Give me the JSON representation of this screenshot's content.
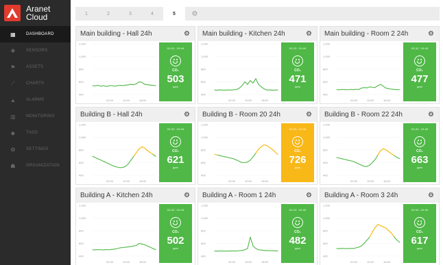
{
  "brand": {
    "line1": "Aranet",
    "line2": "Cloud"
  },
  "sidebar": {
    "items": [
      {
        "label": "DASHBOARD",
        "icon": "dashboard-icon",
        "glyph": "▦"
      },
      {
        "label": "SENSORS",
        "icon": "sensor-icon",
        "glyph": "✺"
      },
      {
        "label": "ASSETS",
        "icon": "asset-icon",
        "glyph": "⚑"
      },
      {
        "label": "CHARTS",
        "icon": "chart-icon",
        "glyph": "⟋"
      },
      {
        "label": "ALARMS",
        "icon": "alarm-icon",
        "glyph": "▲"
      },
      {
        "label": "MONITORING",
        "icon": "monitoring-icon",
        "glyph": "▥"
      },
      {
        "label": "TAGS",
        "icon": "tag-icon",
        "glyph": "◆"
      },
      {
        "label": "SETTINGS",
        "icon": "settings-icon",
        "glyph": "✿"
      },
      {
        "label": "ORGANIZATION",
        "icon": "organization-icon",
        "glyph": "☗"
      }
    ]
  },
  "tabs": [
    "1",
    "2",
    "3",
    "4",
    "5"
  ],
  "active_tab": "5",
  "axis_labels": [
    "1,200",
    "1,000",
    "800",
    "600",
    "400"
  ],
  "x_labels": [
    "02:00",
    "10:00",
    "18:00"
  ],
  "colors": {
    "green": "#4fb846",
    "yellow": "#f8b818",
    "line_green": "#4fb846",
    "line_yellow": "#f5b400"
  },
  "cards": [
    {
      "title": "Main building - Hall 24h",
      "time": "03.02. 19:49",
      "co2": "CO₂",
      "value": "503",
      "unit": "ppm",
      "status": "green",
      "series": [
        540,
        535,
        545,
        530,
        538,
        528,
        536,
        542,
        530,
        538,
        545,
        540,
        548,
        552,
        560,
        555,
        570,
        600,
        590,
        560,
        555,
        548,
        545,
        540
      ]
    },
    {
      "title": "Main building - Kitchen 24h",
      "time": "03.02. 19:49",
      "co2": "CO₂",
      "value": "471",
      "unit": "ppm",
      "status": "green",
      "series": [
        470,
        468,
        472,
        470,
        468,
        472,
        470,
        475,
        480,
        500,
        540,
        600,
        560,
        620,
        580,
        650,
        560,
        520,
        490,
        470,
        472,
        468,
        470,
        471
      ]
    },
    {
      "title": "Main building - Room 2 24h",
      "time": "03.02. 19:49",
      "co2": "CO₂",
      "value": "477",
      "unit": "ppm",
      "status": "green",
      "series": [
        478,
        476,
        480,
        478,
        476,
        480,
        478,
        482,
        480,
        500,
        510,
        505,
        520,
        515,
        510,
        540,
        560,
        530,
        500,
        490,
        485,
        480,
        478,
        477
      ]
    },
    {
      "title": "Building B - Hall 24h",
      "time": "03.02. 19:49",
      "co2": "CO₂",
      "value": "621",
      "unit": "ppm",
      "status": "green",
      "series": [
        700,
        680,
        660,
        640,
        620,
        600,
        580,
        560,
        540,
        530,
        520,
        525,
        540,
        580,
        640,
        700,
        760,
        820,
        850,
        830,
        790,
        760,
        730,
        700
      ]
    },
    {
      "title": "Building B - Room 20 24h",
      "time": "03.02. 19:49",
      "co2": "CO₂",
      "value": "726",
      "unit": "ppm",
      "status": "yellow",
      "series": [
        730,
        720,
        710,
        700,
        690,
        680,
        670,
        660,
        640,
        620,
        600,
        600,
        610,
        640,
        690,
        750,
        810,
        850,
        880,
        870,
        840,
        810,
        770,
        730
      ]
    },
    {
      "title": "Building B - Room 22 24h",
      "time": "03.02. 19:49",
      "co2": "CO₂",
      "value": "663",
      "unit": "ppm",
      "status": "green",
      "series": [
        680,
        670,
        660,
        650,
        640,
        630,
        620,
        600,
        580,
        560,
        540,
        540,
        560,
        600,
        650,
        720,
        790,
        820,
        800,
        770,
        740,
        710,
        680,
        663
      ]
    },
    {
      "title": "Building A - Kitchen 24h",
      "time": "03.02. 19:49",
      "co2": "CO₂",
      "value": "502",
      "unit": "ppm",
      "status": "green",
      "series": [
        500,
        498,
        502,
        500,
        498,
        502,
        500,
        505,
        510,
        520,
        530,
        535,
        540,
        545,
        550,
        560,
        570,
        600,
        590,
        580,
        560,
        540,
        520,
        502
      ]
    },
    {
      "title": "Building A - Room 1 24h",
      "time": "03.02. 19:49",
      "co2": "CO₂",
      "value": "482",
      "unit": "ppm",
      "status": "green",
      "series": [
        480,
        478,
        482,
        480,
        478,
        482,
        480,
        482,
        480,
        485,
        490,
        500,
        520,
        700,
        560,
        520,
        500,
        495,
        490,
        488,
        485,
        484,
        483,
        482
      ]
    },
    {
      "title": "Building A - Room 3 24h",
      "time": "03.02. 19:49",
      "co2": "CO₂",
      "value": "617",
      "unit": "ppm",
      "status": "green",
      "series": [
        520,
        518,
        522,
        520,
        518,
        522,
        520,
        530,
        540,
        560,
        600,
        650,
        700,
        780,
        850,
        900,
        880,
        860,
        840,
        800,
        760,
        700,
        650,
        617
      ]
    }
  ]
}
